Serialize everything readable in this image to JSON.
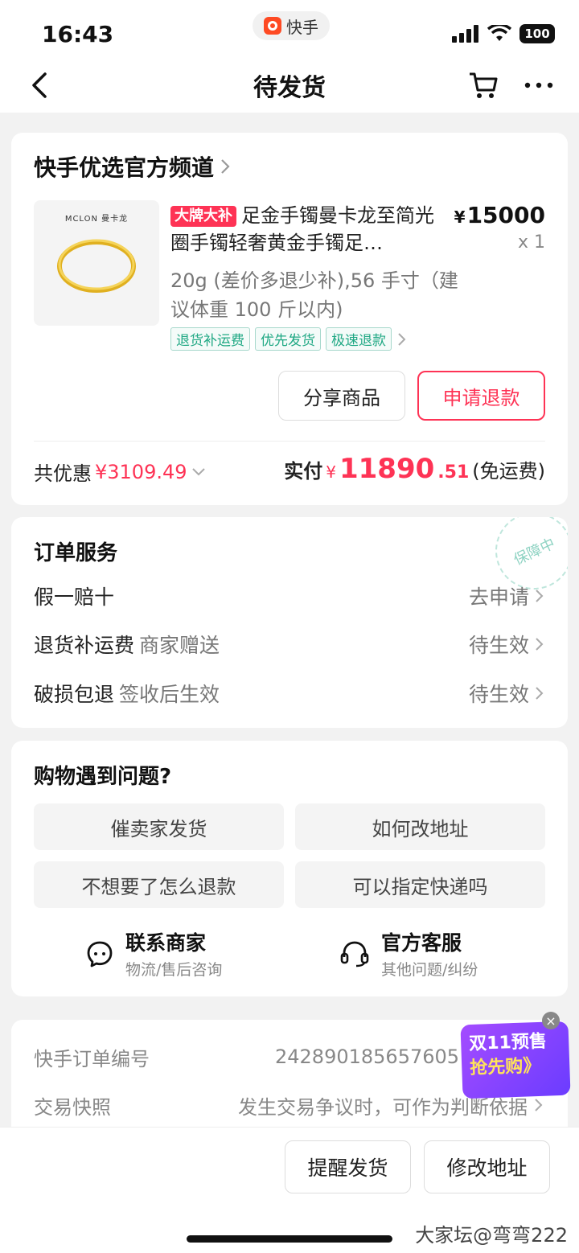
{
  "status_bar": {
    "time": "16:43",
    "app_name": "快手",
    "battery": "100"
  },
  "nav": {
    "title": "待发货"
  },
  "product_card": {
    "shop_name": "快手优选官方频道",
    "image_brand": "MCLON 曼卡龙",
    "badge": "大牌大补",
    "title": "足金手镯曼卡龙至简光圈手镯轻奢黄金手镯足…",
    "price_symbol": "¥",
    "price": "15000",
    "quantity": "x 1",
    "spec": "20g (差价多退少补),56 手寸（建议体重 100 斤以内)",
    "tags": [
      "退货补运费",
      "优先发货",
      "极速退款"
    ],
    "share_button": "分享商品",
    "refund_button": "申请退款",
    "discount_label": "共优惠",
    "discount_value": "¥3109.49",
    "paid_label": "实付",
    "paid_symbol": "¥",
    "paid_integer": "11890",
    "paid_decimal": ".51",
    "paid_note": "(免运费)"
  },
  "services": {
    "title": "订单服务",
    "stamp": "保障中",
    "rows": [
      {
        "label": "假一赔十",
        "sub": "",
        "status": "去申请"
      },
      {
        "label": "退货补运费",
        "sub": "商家赠送",
        "status": "待生效"
      },
      {
        "label": "破损包退",
        "sub": "签收后生效",
        "status": "待生效"
      }
    ]
  },
  "help": {
    "title": "购物遇到问题?",
    "buttons": [
      "催卖家发货",
      "如何改地址",
      "不想要了怎么退款",
      "可以指定快递吗"
    ],
    "contact_merchant": {
      "name": "联系商家",
      "desc": "物流/售后咨询"
    },
    "official_service": {
      "name": "官方客服",
      "desc": "其他问题/纠纷"
    }
  },
  "order_info": {
    "order_no_label": "快手订单编号",
    "order_no_value": "242890185657605",
    "snapshot_label": "交易快照",
    "snapshot_value": "发生交易争议时，可作为判断依据"
  },
  "promo": {
    "line1": "双11预售",
    "line2": "抢先购》"
  },
  "bottom_bar": {
    "remind_button": "提醒发货",
    "address_button": "修改地址"
  },
  "watermark": "大家坛@弯弯222"
}
